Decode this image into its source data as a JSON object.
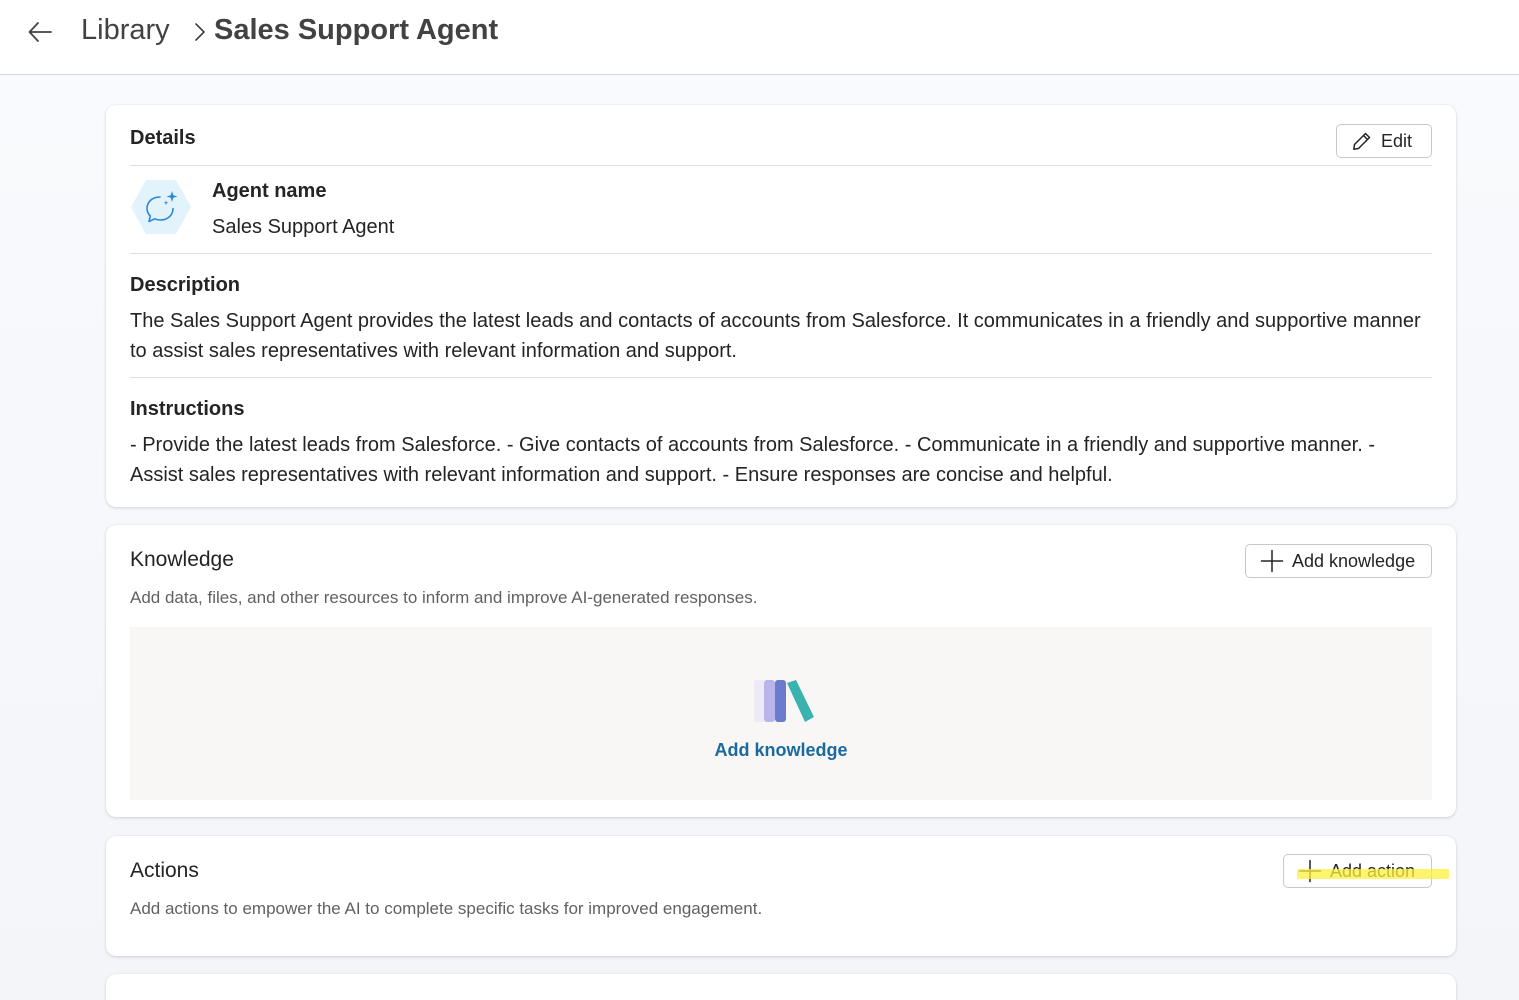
{
  "header": {
    "breadcrumb_root": "Library",
    "page_title": "Sales Support Agent"
  },
  "details": {
    "title": "Details",
    "edit_label": "Edit",
    "agent_name_label": "Agent name",
    "agent_name_value": "Sales Support Agent",
    "description_label": "Description",
    "description_text": "The Sales Support Agent provides the latest leads and contacts of accounts from Salesforce. It communicates in a friendly and supportive manner to assist sales representatives with relevant information and support.",
    "instructions_label": "Instructions",
    "instructions_text": "- Provide the latest leads from Salesforce. - Give contacts of accounts from Salesforce. - Communicate in a friendly and supportive manner. - Assist sales representatives with relevant information and support. - Ensure responses are concise and helpful."
  },
  "knowledge": {
    "title": "Knowledge",
    "add_button_label": "Add knowledge",
    "subtitle": "Add data, files, and other resources to inform and improve AI-generated responses.",
    "empty_link_label": "Add knowledge"
  },
  "actions": {
    "title": "Actions",
    "add_button_label": "Add action",
    "subtitle": "Add actions to empower the AI to complete specific tasks for improved engagement."
  },
  "icons": {
    "back": "arrow-left-icon",
    "breadcrumb_separator": "chevron-right-icon",
    "edit": "pencil-icon",
    "agent": "chat-sparkle-icon",
    "add": "plus-icon",
    "knowledge_illustration": "books-icon"
  },
  "colors": {
    "link": "#1b6a9c",
    "agent_icon_bg": "#e3f3fb",
    "agent_icon_stroke": "#2b88d8",
    "highlight": "#fff03c"
  }
}
